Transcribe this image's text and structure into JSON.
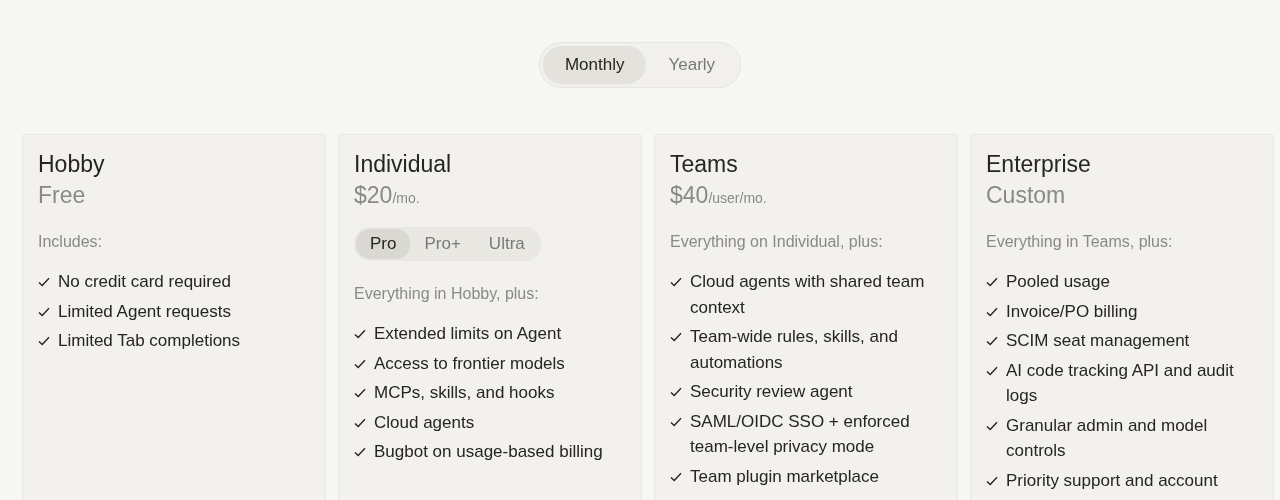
{
  "billing_toggle": [
    {
      "label": "Monthly",
      "selected": true
    },
    {
      "label": "Yearly",
      "selected": false
    }
  ],
  "plans": [
    {
      "name": "Hobby",
      "price": "Free",
      "intro": "Includes:",
      "features": [
        "No credit card required",
        "Limited Agent requests",
        "Limited Tab completions"
      ]
    },
    {
      "name": "Individual",
      "price": "$20",
      "unit": "/mo.",
      "tiers": [
        {
          "label": "Pro",
          "selected": true
        },
        {
          "label": "Pro+",
          "selected": false
        },
        {
          "label": "Ultra",
          "selected": false
        }
      ],
      "intro": "Everything in Hobby, plus:",
      "features": [
        "Extended limits on Agent",
        "Access to frontier models",
        "MCPs, skills, and hooks",
        "Cloud agents",
        "Bugbot on usage-based billing"
      ]
    },
    {
      "name": "Teams",
      "price": "$40",
      "unit": "/user/mo.",
      "intro": "Everything on Individual, plus:",
      "features": [
        "Cloud agents with shared team context",
        "Team-wide rules, skills, and automations",
        "Security review agent",
        "SAML/OIDC SSO + enforced team-level privacy mode",
        "Team plugin marketplace"
      ]
    },
    {
      "name": "Enterprise",
      "price": "Custom",
      "intro": "Everything in Teams, plus:",
      "features": [
        "Pooled usage",
        "Invoice/PO billing",
        "SCIM seat management",
        "AI code tracking API and audit logs",
        "Granular admin and model controls",
        "Priority support and account"
      ]
    }
  ]
}
